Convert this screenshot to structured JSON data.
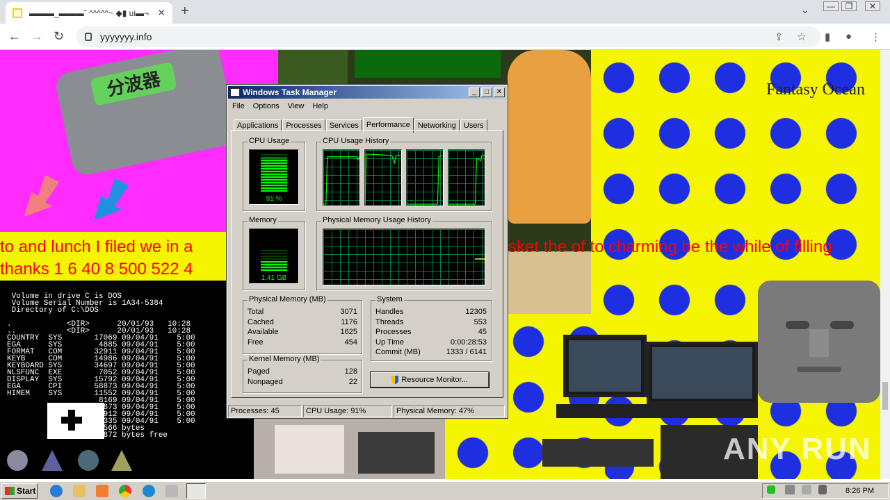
{
  "browser": {
    "tab_title": "▬▬▬_▬▬▬˜ ^^^^^~ ◆▮ ui▬¬",
    "tab_close": "✕",
    "new_tab": "+",
    "url": "yyyyyyy.info",
    "window_controls": [
      "—",
      "❐",
      "✕"
    ]
  },
  "page": {
    "splitter_label": "分波器",
    "red_line_left_1": "to and lunch I filed we in a",
    "red_line_left_2": "thanks 1 6 40 8 500 522 4",
    "red_line_right": "sket the of to charming be the while of filling",
    "fantasy_heading": "Fantasy Ocean",
    "dos_listing": " Volume in drive C is DOS\n Volume Serial Number is 1A34-5384\n Directory of C:\\DOS\n\n.            <DIR>      20/01/93   10:28\n..           <DIR>      20/01/93   10:28\nCOUNTRY  SYS       17069 09/04/91    5:00\nEGA      SYS        4885 09/04/91    5:00\nFORMAT   COM       32911 09/04/91    5:00\nKEYB     COM       14986 09/04/91    5:00\nKEYBOARD SYS       34697 09/04/91    5:00\nNLSFUNC  EXE        7052 09/04/91    5:00\nDISPLAY  SYS       15792 09/04/91    5:00\nEGA      CPI       58873 09/04/91    5:00\nHIMEM    SYS       11552 09/04/91    5:00\n                    8169 09/04/91    5:00\n                    5873 09/04/91    5:00\n                    0912 09/04/91    5:00\n                    8335 09/04/91    5:00\n                 2058566 bytes\n                11087872 bytes free",
    "watermark": "ANY RUN"
  },
  "taskmgr": {
    "title": "Windows Task Manager",
    "menu": [
      "File",
      "Options",
      "View",
      "Help"
    ],
    "tabs": [
      "Applications",
      "Processes",
      "Services",
      "Performance",
      "Networking",
      "Users"
    ],
    "active_tab": "Performance",
    "cpu_usage_label": "CPU Usage",
    "cpu_usage_value": "91 %",
    "cpu_usage_fraction": 0.91,
    "cpu_history_label": "CPU Usage History",
    "memory_label": "Memory",
    "memory_value": "1.41 GB",
    "memory_fraction": 0.47,
    "phys_mem_history_label": "Physical Memory Usage History",
    "physical_memory": {
      "title": "Physical Memory (MB)",
      "rows": [
        {
          "k": "Total",
          "v": "3071"
        },
        {
          "k": "Cached",
          "v": "1176"
        },
        {
          "k": "Available",
          "v": "1625"
        },
        {
          "k": "Free",
          "v": "454"
        }
      ]
    },
    "kernel_memory": {
      "title": "Kernel Memory (MB)",
      "rows": [
        {
          "k": "Paged",
          "v": "128"
        },
        {
          "k": "Nonpaged",
          "v": "22"
        }
      ]
    },
    "system": {
      "title": "System",
      "rows": [
        {
          "k": "Handles",
          "v": "12305"
        },
        {
          "k": "Threads",
          "v": "553"
        },
        {
          "k": "Processes",
          "v": "45"
        },
        {
          "k": "Up Time",
          "v": "0:00:28:53"
        },
        {
          "k": "Commit (MB)",
          "v": "1333 / 6141"
        }
      ]
    },
    "resource_monitor_button": "Resource Monitor...",
    "status": {
      "processes": "Processes: 45",
      "cpu": "CPU Usage: 91%",
      "memory": "Physical Memory: 47%"
    }
  },
  "taskbar": {
    "start_label": "Start",
    "clock": "8:26 PM"
  },
  "colors": {
    "meter_green": "#00ff00",
    "grid_green": "#008040",
    "titlebar_start": "#0a246a",
    "titlebar_end": "#a6caf0"
  }
}
